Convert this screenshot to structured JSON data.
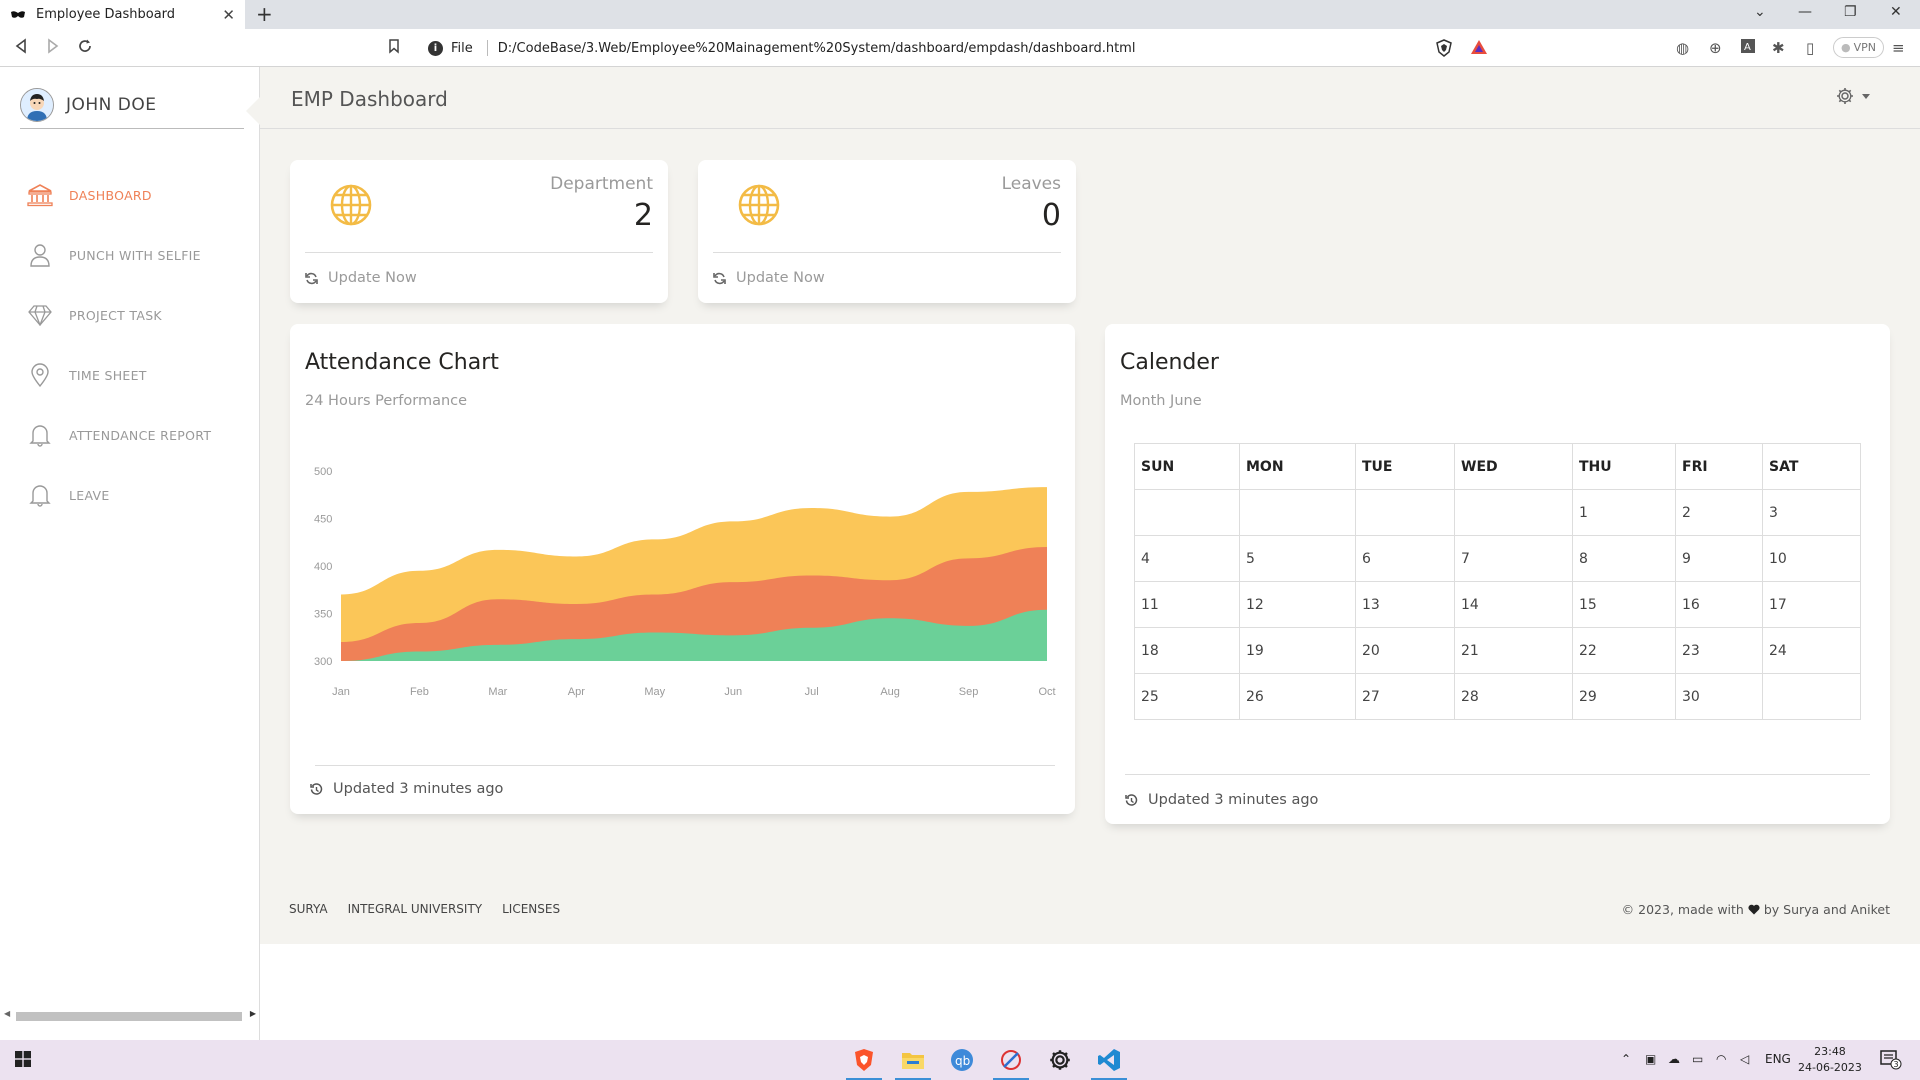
{
  "browser": {
    "tab_title": "Employee Dashboard",
    "tab_close": "✕",
    "new_tab": "+",
    "url_protocol": "File",
    "url": "D:/CodeBase/3.Web/Employee%20Mainagement%20System/dashboard/empdash/dashboard.html",
    "vpn_label": "VPN"
  },
  "sidebar": {
    "user_name": "JOHN DOE",
    "items": [
      {
        "label": "DASHBOARD",
        "icon": "bank-icon",
        "active": true
      },
      {
        "label": "PUNCH WITH SELFIE",
        "icon": "user-icon"
      },
      {
        "label": "PROJECT TASK",
        "icon": "diamond-icon"
      },
      {
        "label": "TIME SHEET",
        "icon": "pin-icon"
      },
      {
        "label": "ATTENDANCE REPORT",
        "icon": "bell-icon"
      },
      {
        "label": "LEAVE",
        "icon": "bell-icon"
      }
    ]
  },
  "header": {
    "title": "EMP Dashboard"
  },
  "stats": [
    {
      "title": "Department",
      "value": "2",
      "footer": "Update Now"
    },
    {
      "title": "Leaves",
      "value": "0",
      "footer": "Update Now"
    }
  ],
  "attendance": {
    "title": "Attendance Chart",
    "subtitle": "24 Hours Performance",
    "footer": "Updated 3 minutes ago"
  },
  "calendar": {
    "title": "Calender",
    "subtitle": "Month June",
    "days": [
      "SUN",
      "MON",
      "TUE",
      "WED",
      "THU",
      "FRI",
      "SAT"
    ],
    "weeks": [
      [
        "",
        "",
        "",
        "",
        "1",
        "2",
        "3"
      ],
      [
        "4",
        "5",
        "6",
        "7",
        "8",
        "9",
        "10"
      ],
      [
        "11",
        "12",
        "13",
        "14",
        "15",
        "16",
        "17"
      ],
      [
        "18",
        "19",
        "20",
        "21",
        "22",
        "23",
        "24"
      ],
      [
        "25",
        "26",
        "27",
        "28",
        "29",
        "30",
        ""
      ]
    ],
    "footer": "Updated 3 minutes ago"
  },
  "footer": {
    "links": [
      "SURYA",
      "INTEGRAL UNIVERSITY",
      "LICENSES"
    ],
    "copy_before": "© 2023, made with",
    "copy_after": "by Surya and Aniket"
  },
  "taskbar": {
    "lang": "ENG",
    "time": "23:48",
    "date": "24-06-2023",
    "notifications": "3"
  },
  "colors": {
    "accent": "#ef8157",
    "warning": "#fbc658",
    "success": "#6bd098",
    "globe": "#f3bb45"
  },
  "chart_data": {
    "type": "area",
    "title": "Attendance Chart",
    "subtitle": "24 Hours Performance",
    "categories": [
      "Jan",
      "Feb",
      "Mar",
      "Apr",
      "May",
      "Jun",
      "Jul",
      "Aug",
      "Sep",
      "Oct"
    ],
    "y_ticks": [
      300,
      350,
      400,
      450,
      500
    ],
    "ylim": [
      300,
      500
    ],
    "stacked": true,
    "series": [
      {
        "color": "#6bd098",
        "values": [
          300,
          310,
          317,
          323,
          330,
          327,
          335,
          345,
          337,
          354
        ]
      },
      {
        "color": "#ef8157",
        "values": [
          320,
          340,
          365,
          360,
          370,
          383,
          390,
          385,
          408,
          420
        ]
      },
      {
        "color": "#fbc658",
        "values": [
          370,
          395,
          417,
          410,
          428,
          447,
          461,
          452,
          478,
          483
        ]
      }
    ]
  }
}
